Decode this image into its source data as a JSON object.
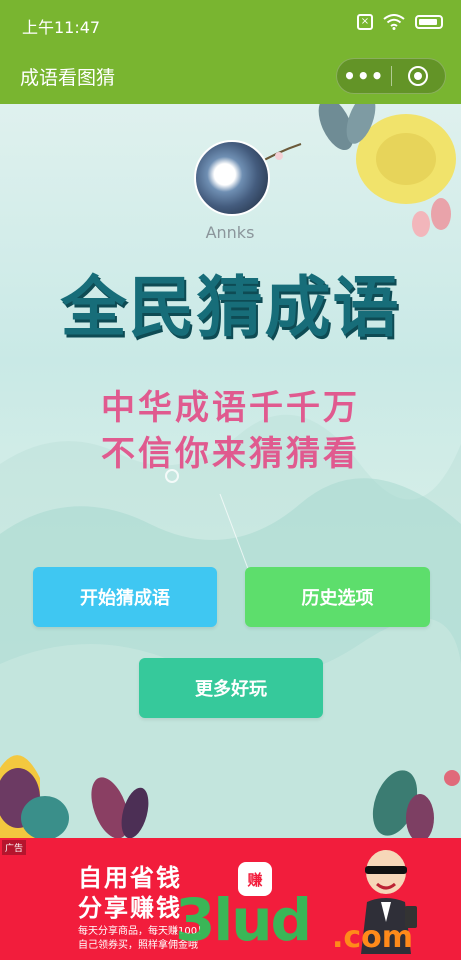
{
  "status_bar": {
    "time": "上午11:47",
    "icons": [
      "sim-off-icon",
      "wifi-icon",
      "battery-icon"
    ]
  },
  "nav": {
    "title": "成语看图猜",
    "more_label": "•••",
    "close_icon": "target-icon"
  },
  "profile": {
    "nickname": "Annks"
  },
  "hero": {
    "title": "全民猜成语",
    "subtitle_line1": "中华成语千千万",
    "subtitle_line2": "不信你来猜猜看"
  },
  "buttons": {
    "start": "开始猜成语",
    "history": "历史选项",
    "more": "更多好玩"
  },
  "ad": {
    "tag": "广告",
    "headline1": "自用省钱",
    "headline2": "分享赚钱",
    "line1": "每天分享商品，每天赚100！",
    "line2": "自己领券买，照样拿佣金哦",
    "badge": "赚",
    "watermark": "3lud",
    "watermark_suffix": ".com"
  },
  "colors": {
    "nav_bg": "#79b530",
    "btn_start": "#3fc7f2",
    "btn_history": "#5dde6c",
    "btn_more": "#36c99b",
    "title_color": "#176d79",
    "subtitle_color": "#e05a8f",
    "ad_bg": "#f21d3c"
  }
}
